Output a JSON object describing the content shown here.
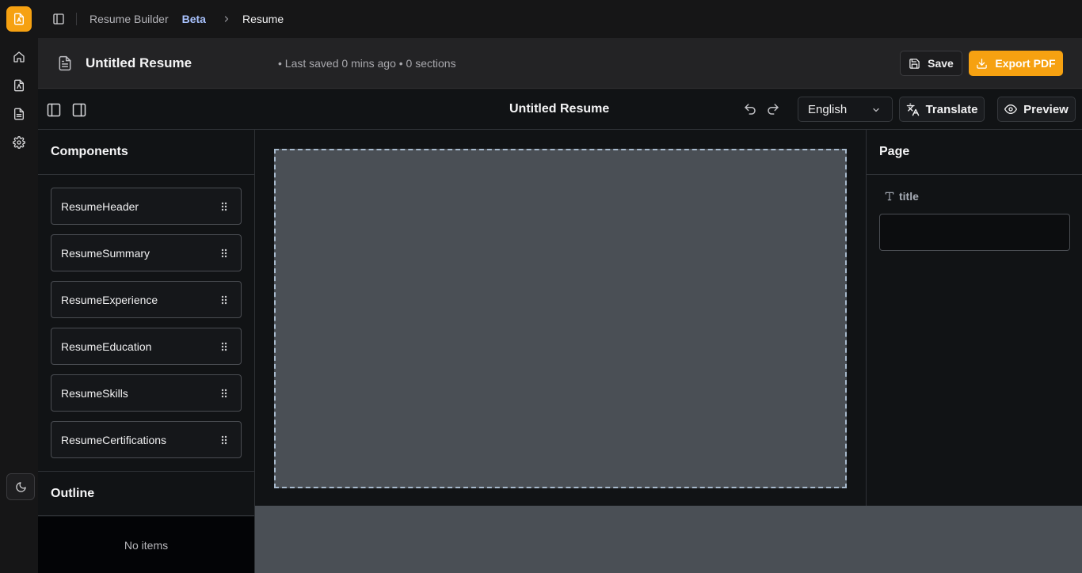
{
  "colors": {
    "accent": "#f6a111",
    "beta": "#a9c3ff",
    "canvas": "#4a4f55"
  },
  "rail": {
    "logo_icon": "resume-file-icon",
    "items": [
      {
        "icon": "home-icon"
      },
      {
        "icon": "resume-file-icon"
      },
      {
        "icon": "document-icon"
      },
      {
        "icon": "gear-icon"
      }
    ],
    "theme_icon": "moon-icon"
  },
  "breadcrumb": {
    "app": "Resume Builder",
    "badge": "Beta",
    "current": "Resume"
  },
  "document": {
    "title": "Untitled Resume",
    "meta": "• Last saved 0 mins ago • 0 sections",
    "save_label": "Save",
    "export_label": "Export PDF"
  },
  "toolbar": {
    "title": "Untitled Resume",
    "language": "English",
    "translate_label": "Translate",
    "preview_label": "Preview"
  },
  "components": {
    "heading": "Components",
    "items": [
      "ResumeHeader",
      "ResumeSummary",
      "ResumeExperience",
      "ResumeEducation",
      "ResumeSkills",
      "ResumeCertifications"
    ]
  },
  "outline": {
    "heading": "Outline",
    "empty_text": "No items"
  },
  "properties": {
    "heading": "Page",
    "field_label": "title",
    "field_value": ""
  }
}
